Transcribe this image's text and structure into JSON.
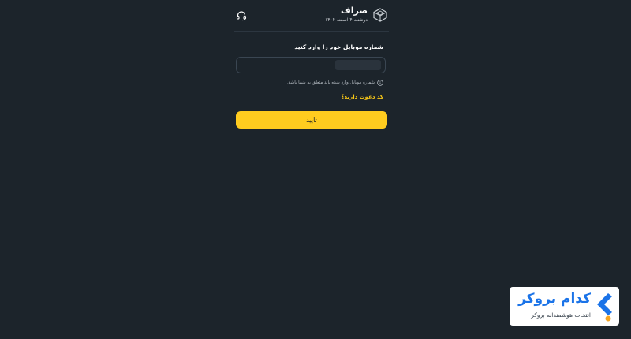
{
  "header": {
    "title": "صراف",
    "date": "دوشنبه ۴ اسفند ۱۴۰۴",
    "logo_icon": "cube-logo-icon",
    "support_icon": "headset-icon"
  },
  "form": {
    "label": "شماره موبایل خود را وارد کنید",
    "phone_value": "",
    "hint": "شماره موبایل وارد شده باید متعلق به شما باشد.",
    "hint_icon": "info-icon",
    "invite_link": "کد دعوت دارید؟",
    "submit_label": "تایید"
  },
  "watermark": {
    "title": "کدام بروکر",
    "subtitle": "انتخاب هوشمندانه بروکر",
    "brand_color": "#1a73e8",
    "accent_color": "#f5a623"
  },
  "colors": {
    "background": "#1c242b",
    "accent": "#ffcc1f",
    "link": "#f5c518"
  }
}
